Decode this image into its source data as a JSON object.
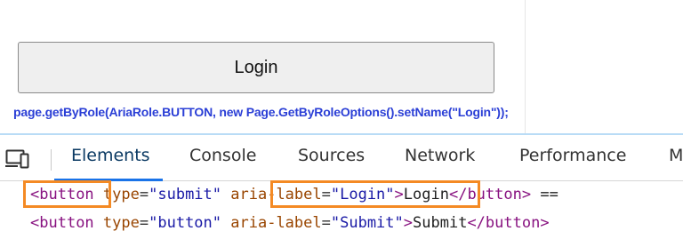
{
  "page": {
    "login_button_label": "Login",
    "code_caption": "page.getByRole(AriaRole.BUTTON, new Page.GetByRoleOptions().setName(\"Login\"));"
  },
  "devtools": {
    "tabs": [
      {
        "label": "Elements",
        "active": true
      },
      {
        "label": "Console",
        "active": false
      },
      {
        "label": "Sources",
        "active": false
      },
      {
        "label": "Network",
        "active": false
      },
      {
        "label": "Performance",
        "active": false
      },
      {
        "label": "M",
        "active": false
      }
    ],
    "lines": [
      {
        "open_bracket": "<",
        "tag": "button",
        "attr1_name": "type",
        "attr1_value": "\"submit\"",
        "attr2_name": "aria-label",
        "attr2_value": "\"Login\"",
        "close_bracket": ">",
        "text": "Login",
        "end_tag": "</button>",
        "suffix": "=="
      },
      {
        "open_bracket": "<",
        "tag": "button",
        "attr1_name": "type",
        "attr1_value": "\"button\"",
        "attr2_name": "aria-label",
        "attr2_value": "\"Submit\"",
        "close_bracket": ">",
        "text": "Submit",
        "end_tag": "</button>"
      }
    ],
    "icons": {
      "device_toggle": "device-toggle-icon"
    },
    "colors": {
      "highlight": "#f48a24",
      "tag": "#881280",
      "attribute": "#994500",
      "value": "#1a1aa6",
      "active_tab_underline": "#1a73e8",
      "caption": "#2b3fd6"
    }
  }
}
